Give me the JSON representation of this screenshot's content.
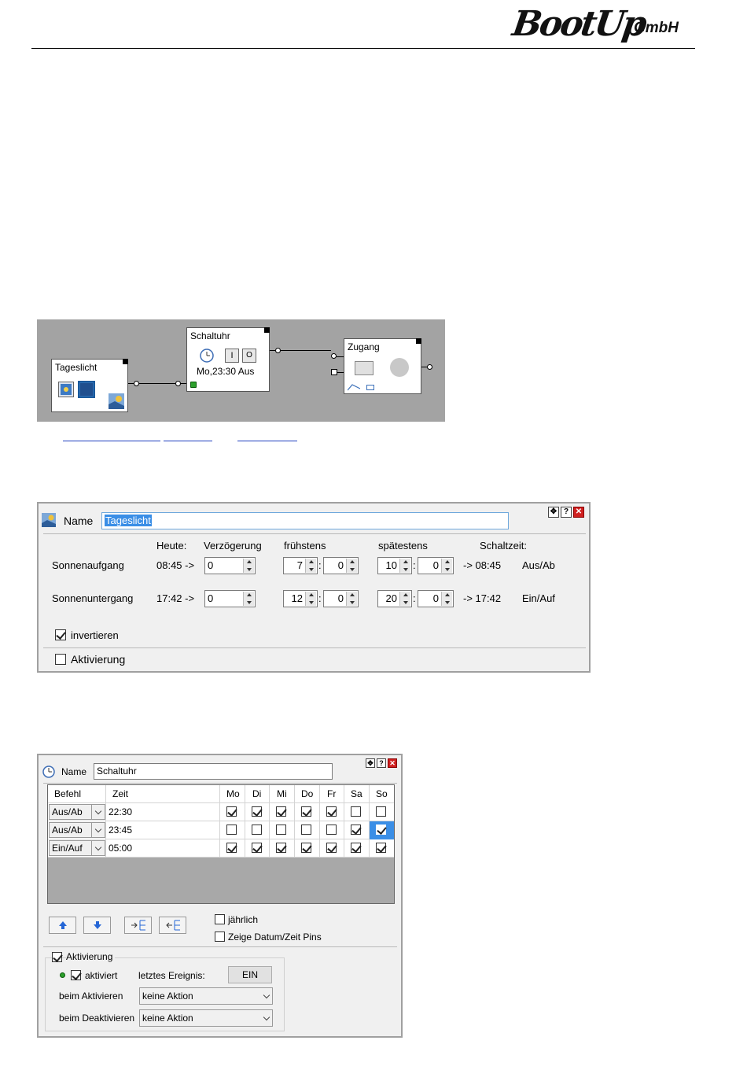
{
  "header": {
    "logo_main": "BootUp",
    "logo_sub": "GmbH"
  },
  "diagram": {
    "blocks": {
      "tageslicht": {
        "title": "Tageslicht"
      },
      "schaltuhr": {
        "title": "Schaltuhr",
        "status": "Mo,23:30 Aus",
        "btn_on": "I",
        "btn_off": "O"
      },
      "zugang": {
        "title": "Zugang"
      }
    }
  },
  "dialog1": {
    "name_label": "Name",
    "name_value": "Tageslicht",
    "headers": {
      "heute": "Heute:",
      "verzoegerung": "Verzögerung",
      "fruehstens": "frühstens",
      "spaetestens": "spätestens",
      "schaltzeit": "Schaltzeit:"
    },
    "rows": [
      {
        "label": "Sonnenaufgang",
        "heute": "08:45 ->",
        "delay": "0",
        "early_h": "7",
        "early_m": "0",
        "late_h": "10",
        "late_m": "0",
        "arrow_time": "-> 08:45",
        "action": "Aus/Ab"
      },
      {
        "label": "Sonnenuntergang",
        "heute": "17:42 ->",
        "delay": "0",
        "early_h": "12",
        "early_m": "0",
        "late_h": "20",
        "late_m": "0",
        "arrow_time": "-> 17:42",
        "action": "Ein/Auf"
      }
    ],
    "colon": ":",
    "invertieren": "invertieren",
    "aktivierung": "Aktivierung"
  },
  "dialog2": {
    "name_label": "Name",
    "name_value": "Schaltuhr",
    "columns": [
      "Befehl",
      "Zeit",
      "Mo",
      "Di",
      "Mi",
      "Do",
      "Fr",
      "Sa",
      "So"
    ],
    "rows": [
      {
        "befehl": "Aus/Ab",
        "zeit": "22:30",
        "days": [
          true,
          true,
          true,
          true,
          true,
          false,
          false
        ]
      },
      {
        "befehl": "Aus/Ab",
        "zeit": "23:45",
        "days": [
          false,
          false,
          false,
          false,
          false,
          true,
          true
        ]
      },
      {
        "befehl": "Ein/Auf",
        "zeit": "05:00",
        "days": [
          true,
          true,
          true,
          true,
          true,
          true,
          true
        ]
      }
    ],
    "jaehrlich": "jährlich",
    "zeige_pins": "Zeige Datum/Zeit Pins",
    "aktivierung": "Aktivierung",
    "aktiviert": "aktiviert",
    "letztes_ereignis": "letztes Ereignis:",
    "ein_button": "EIN",
    "beim_aktivieren": "beim Aktivieren",
    "beim_aktivieren_value": "keine Aktion",
    "beim_deaktivieren": "beim Deaktivieren",
    "beim_deaktivieren_value": "keine Aktion"
  }
}
